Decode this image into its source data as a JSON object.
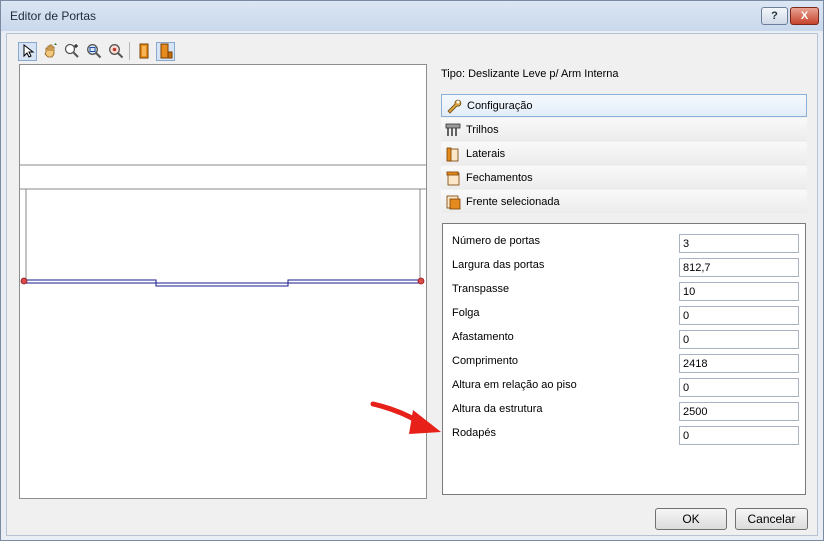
{
  "window": {
    "title": "Editor de Portas",
    "help_label": "?",
    "close_label": "X"
  },
  "toolbar": {
    "tools": [
      "pointer-icon",
      "pan-hand-icon",
      "zoom-in-icon",
      "zoom-window-icon",
      "zoom-extents-icon",
      "door-front-icon",
      "door-side-icon"
    ]
  },
  "tipo_label": "Tipo: Deslizante Leve p/ Arm Interna",
  "sections": [
    {
      "label": "Configuração",
      "icon": "wrench-icon",
      "selected": true
    },
    {
      "label": "Trilhos",
      "icon": "rails-icon",
      "selected": false
    },
    {
      "label": "Laterais",
      "icon": "laterais-icon",
      "selected": false
    },
    {
      "label": "Fechamentos",
      "icon": "fechamentos-icon",
      "selected": false
    },
    {
      "label": "Frente selecionada",
      "icon": "frente-icon",
      "selected": false
    }
  ],
  "properties": [
    {
      "label": "Número de portas",
      "value": "3"
    },
    {
      "label": "Largura das portas",
      "value": "812,7"
    },
    {
      "label": "Transpasse",
      "value": "10"
    },
    {
      "label": "Folga",
      "value": "0"
    },
    {
      "label": "Afastamento",
      "value": "0"
    },
    {
      "label": "Comprimento",
      "value": "2418"
    },
    {
      "label": "Altura em relação ao piso",
      "value": "0"
    },
    {
      "label": "Altura da estrutura",
      "value": "2500"
    },
    {
      "label": "Rodapés",
      "value": "0"
    }
  ],
  "buttons": {
    "ok": "OK",
    "cancel": "Cancelar"
  },
  "colors": {
    "arrow": "#e8201a",
    "door_line": "#1a1a8c",
    "accent_orange": "#e58a1f"
  }
}
